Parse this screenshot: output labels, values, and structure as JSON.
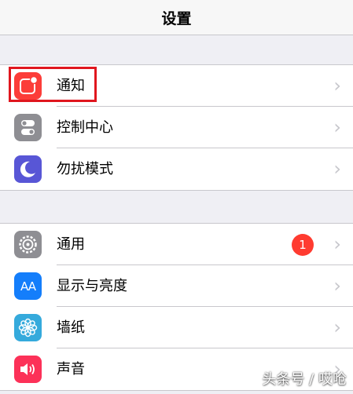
{
  "nav": {
    "title": "设置"
  },
  "group1": [
    {
      "label": "通知",
      "icon": "notifications-icon",
      "color": "#fc3d39"
    },
    {
      "label": "控制中心",
      "icon": "control-center-icon",
      "color": "#8e8e93"
    },
    {
      "label": "勿扰模式",
      "icon": "moon-icon",
      "color": "#5856d6"
    }
  ],
  "group2": [
    {
      "label": "通用",
      "icon": "gear-icon",
      "color": "#8e8e93",
      "badge": "1"
    },
    {
      "label": "显示与亮度",
      "icon": "display-icon",
      "color": "#147efb"
    },
    {
      "label": "墙纸",
      "icon": "flower-icon",
      "color": "#35aadc"
    },
    {
      "label": "声音",
      "icon": "speaker-icon",
      "color": "#fc3158"
    }
  ],
  "icon_texts": {
    "display": "AA"
  },
  "watermark": "头条号 / 哎呛"
}
